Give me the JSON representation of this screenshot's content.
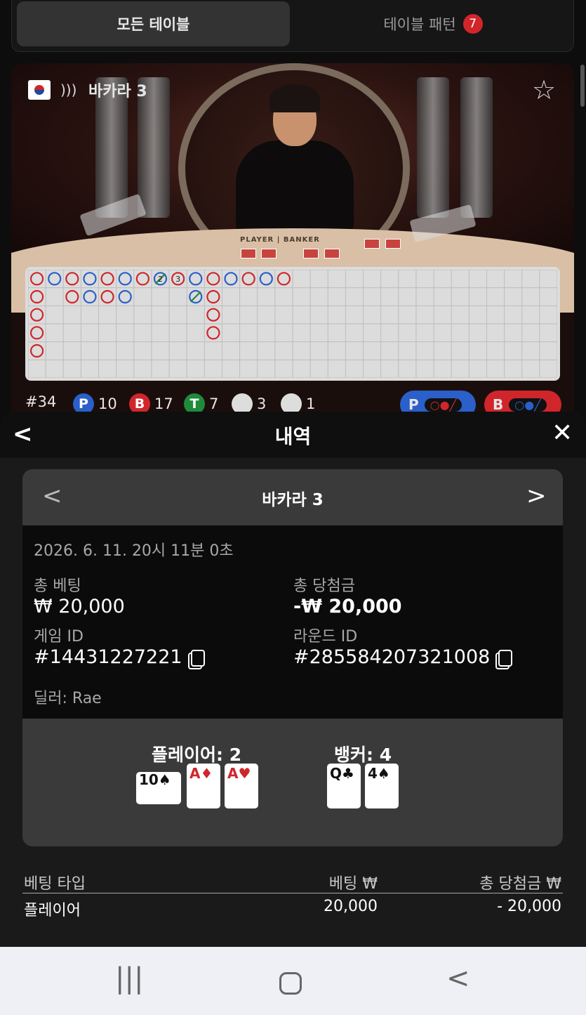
{
  "tabs": {
    "all_tables": "모든 테이블",
    "patterns": "테이블 패턴",
    "patterns_badge": "7"
  },
  "table": {
    "name": "바카라 3",
    "felt_label": "PLAYER | BANKER",
    "round_no": "#34",
    "stats": {
      "player": "10",
      "banker": "17",
      "tie": "7",
      "player_pair": "3",
      "banker_pair": "1"
    },
    "predict_player": "P",
    "predict_banker": "B"
  },
  "road_marks": [
    [
      0,
      0,
      "r"
    ],
    [
      1,
      0,
      "b"
    ],
    [
      2,
      0,
      "r"
    ],
    [
      3,
      0,
      "b"
    ],
    [
      4,
      0,
      "r"
    ],
    [
      5,
      0,
      "b"
    ],
    [
      6,
      0,
      "r"
    ],
    [
      7,
      0,
      "g",
      "2"
    ],
    [
      8,
      0,
      "r",
      "3"
    ],
    [
      9,
      0,
      "b"
    ],
    [
      10,
      0,
      "r"
    ],
    [
      11,
      0,
      "b"
    ],
    [
      12,
      0,
      "r"
    ],
    [
      13,
      0,
      "b"
    ],
    [
      14,
      0,
      "r"
    ],
    [
      0,
      1,
      "r"
    ],
    [
      2,
      1,
      "r"
    ],
    [
      3,
      1,
      "b"
    ],
    [
      4,
      1,
      "r"
    ],
    [
      5,
      1,
      "b"
    ],
    [
      9,
      1,
      "g"
    ],
    [
      10,
      1,
      "r"
    ],
    [
      0,
      2,
      "r"
    ],
    [
      10,
      2,
      "r"
    ],
    [
      0,
      3,
      "r"
    ],
    [
      10,
      3,
      "r"
    ],
    [
      0,
      4,
      "r"
    ]
  ],
  "history": {
    "title": "내역",
    "round_title": "바카라 3",
    "datetime": "2026. 6. 11. 20시 11분 0초",
    "total_bet_label": "총 베팅",
    "total_bet": "₩ 20,000",
    "total_win_label": "총 당첨금",
    "total_win": "-₩ 20,000",
    "game_id_label": "게임 ID",
    "game_id": "#14431227221",
    "round_id_label": "라운드 ID",
    "round_id": "#285584207321008",
    "dealer": "딜러: Rae",
    "player_hand": "플레이어: 2",
    "banker_hand": "뱅커: 4",
    "player_cards": [
      {
        "rank": "10",
        "suit": "♠",
        "color": "black"
      },
      {
        "rank": "A",
        "suit": "♦",
        "color": "red"
      },
      {
        "rank": "A",
        "suit": "♥",
        "color": "red"
      }
    ],
    "banker_cards": [
      {
        "rank": "Q",
        "suit": "♣",
        "color": "black"
      },
      {
        "rank": "4",
        "suit": "♠",
        "color": "black"
      }
    ],
    "bets_header": {
      "type": "베팅 타입",
      "bet": "베팅 ₩",
      "win": "총 당첨금 ₩"
    },
    "bets": [
      {
        "type": "플레이어",
        "bet": "20,000",
        "win": "- 20,000"
      }
    ]
  },
  "colors": {
    "red": "#d0262b",
    "blue": "#2b5fc9",
    "green": "#1e8a3a"
  }
}
